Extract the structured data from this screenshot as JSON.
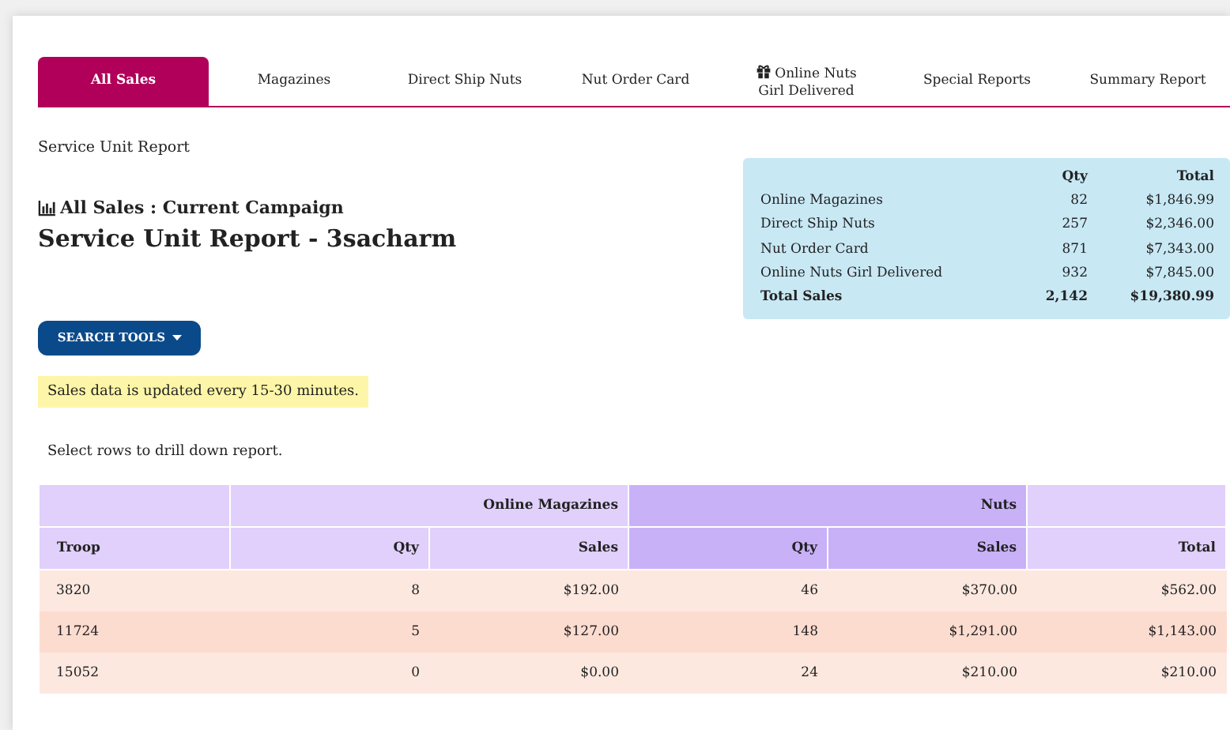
{
  "tabs": [
    {
      "label": "All Sales",
      "selected": true,
      "gift_icon": false
    },
    {
      "label": "Magazines",
      "selected": false,
      "gift_icon": false
    },
    {
      "label": "Direct Ship Nuts",
      "selected": false,
      "gift_icon": false
    },
    {
      "label": "Nut Order Card",
      "selected": false,
      "gift_icon": false
    },
    {
      "label": "Online Nuts Girl Delivered",
      "selected": false,
      "gift_icon": true
    },
    {
      "label": "Special Reports",
      "selected": false,
      "gift_icon": false
    },
    {
      "label": "Summary Report",
      "selected": false,
      "gift_icon": false
    }
  ],
  "breadcrumb": "Service Unit Report",
  "subtitle": "All Sales : Current Campaign",
  "title": "Service Unit Report - 3sacharm",
  "summary": {
    "columns": [
      "Qty",
      "Total"
    ],
    "rows": [
      {
        "label": "Online Magazines",
        "qty": "82",
        "total": "$1,846.99",
        "total_row": false
      },
      {
        "label": "Direct Ship Nuts",
        "qty": "257",
        "total": "$2,346.00",
        "total_row": false
      },
      {
        "label": "Nut Order Card",
        "qty": "871",
        "total": "$7,343.00",
        "total_row": false
      },
      {
        "label": "Online Nuts Girl Delivered",
        "qty": "932",
        "total": "$7,845.00",
        "total_row": false
      },
      {
        "label": "Total Sales",
        "qty": "2,142",
        "total": "$19,380.99",
        "total_row": true
      }
    ]
  },
  "search_button": "SEARCH TOOLS",
  "notice": "Sales data is updated every 15-30 minutes.",
  "hint": "Select rows to drill down report.",
  "table": {
    "groups": [
      "Online Magazines",
      "Nuts"
    ],
    "columns": [
      "Troop",
      "Qty",
      "Sales",
      "Qty",
      "Sales",
      "Total"
    ],
    "rows": [
      [
        "3820",
        "8",
        "$192.00",
        "46",
        "$370.00",
        "$562.00"
      ],
      [
        "11724",
        "5",
        "$127.00",
        "148",
        "$1,291.00",
        "$1,143.00"
      ],
      [
        "15052",
        "0",
        "$0.00",
        "24",
        "$210.00",
        "$210.00"
      ]
    ]
  }
}
